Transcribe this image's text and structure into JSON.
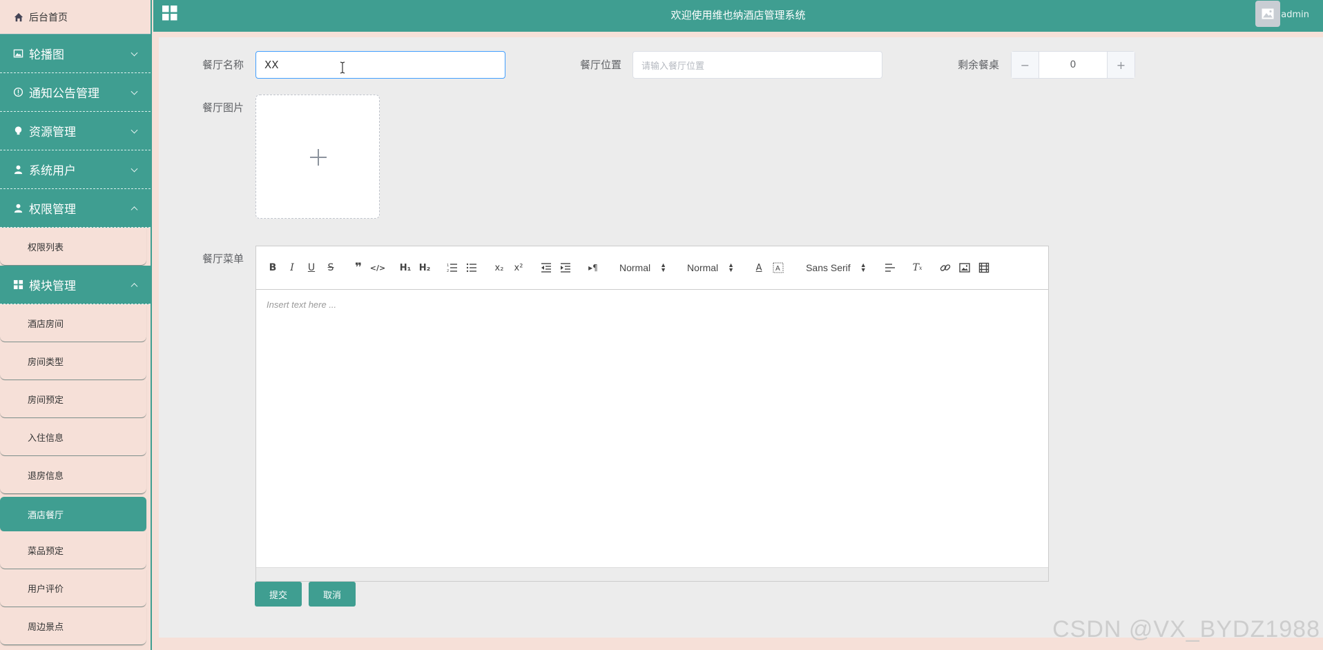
{
  "sidebar": {
    "home": "后台首页",
    "groups": {
      "carousel": "轮播图",
      "notice": "通知公告管理",
      "resource": "资源管理",
      "sysuser": "系统用户",
      "permission": "权限管理",
      "module": "模块管理"
    },
    "permission_items": [
      "权限列表"
    ],
    "module_items": [
      "酒店房间",
      "房间类型",
      "房间预定",
      "入住信息",
      "退房信息",
      "酒店餐厅",
      "菜品预定",
      "用户评价",
      "周边景点"
    ],
    "active_item": "酒店餐厅"
  },
  "header": {
    "title": "欢迎使用维也纳酒店管理系统",
    "username": "admin"
  },
  "form": {
    "name_label": "餐厅名称",
    "name_value": "XX",
    "location_label": "餐厅位置",
    "location_placeholder": "请输入餐厅位置",
    "tables_label": "剩余餐桌",
    "tables_value": "0",
    "stepper_minus": "−",
    "stepper_plus": "+",
    "image_label": "餐厅图片",
    "menu_label": "餐厅菜单",
    "editor": {
      "header_picker": "Normal",
      "size_picker": "Normal",
      "font_picker": "Sans Serif",
      "placeholder": "Insert text here ..."
    },
    "submit_label": "提交",
    "cancel_label": "取消"
  },
  "watermark": "CSDN @VX_BYDZ1988",
  "colors": {
    "primary": "#3f9e91",
    "sidebar_bg": "#f6e0d8",
    "main_bg": "#ececec",
    "focus_border": "#409eff"
  }
}
